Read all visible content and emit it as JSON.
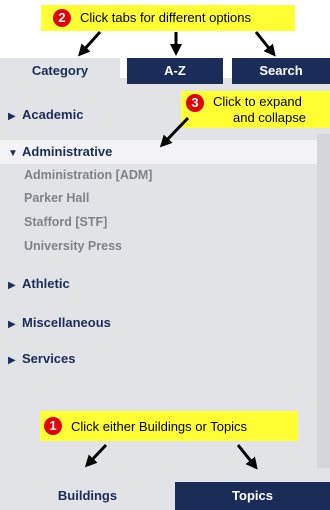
{
  "tabs": {
    "category": "Category",
    "az": "A-Z",
    "search": "Search"
  },
  "callouts": {
    "tabs": {
      "number": "2",
      "text": "Click tabs for different options"
    },
    "expand": {
      "number": "3",
      "line1": "Click to expand",
      "line2": "and collapse"
    },
    "bottom": {
      "number": "1",
      "text": "Click either Buildings or Topics"
    }
  },
  "categories": {
    "academic": "Academic",
    "administrative": "Administrative",
    "athletic": "Athletic",
    "miscellaneous": "Miscellaneous",
    "services": "Services"
  },
  "administrative_items": [
    "Administration [ADM]",
    "Parker Hall",
    "Stafford [STF]",
    "University Press"
  ],
  "bottom_tabs": {
    "buildings": "Buildings",
    "topics": "Topics"
  },
  "colors": {
    "navy": "#1a2d58",
    "callout_yellow": "#ffff33",
    "badge_red": "#e30000",
    "panel_gray": "#e2e3e7"
  },
  "icons": {
    "collapsed": "triangle-right-icon",
    "expanded": "triangle-down-icon"
  }
}
